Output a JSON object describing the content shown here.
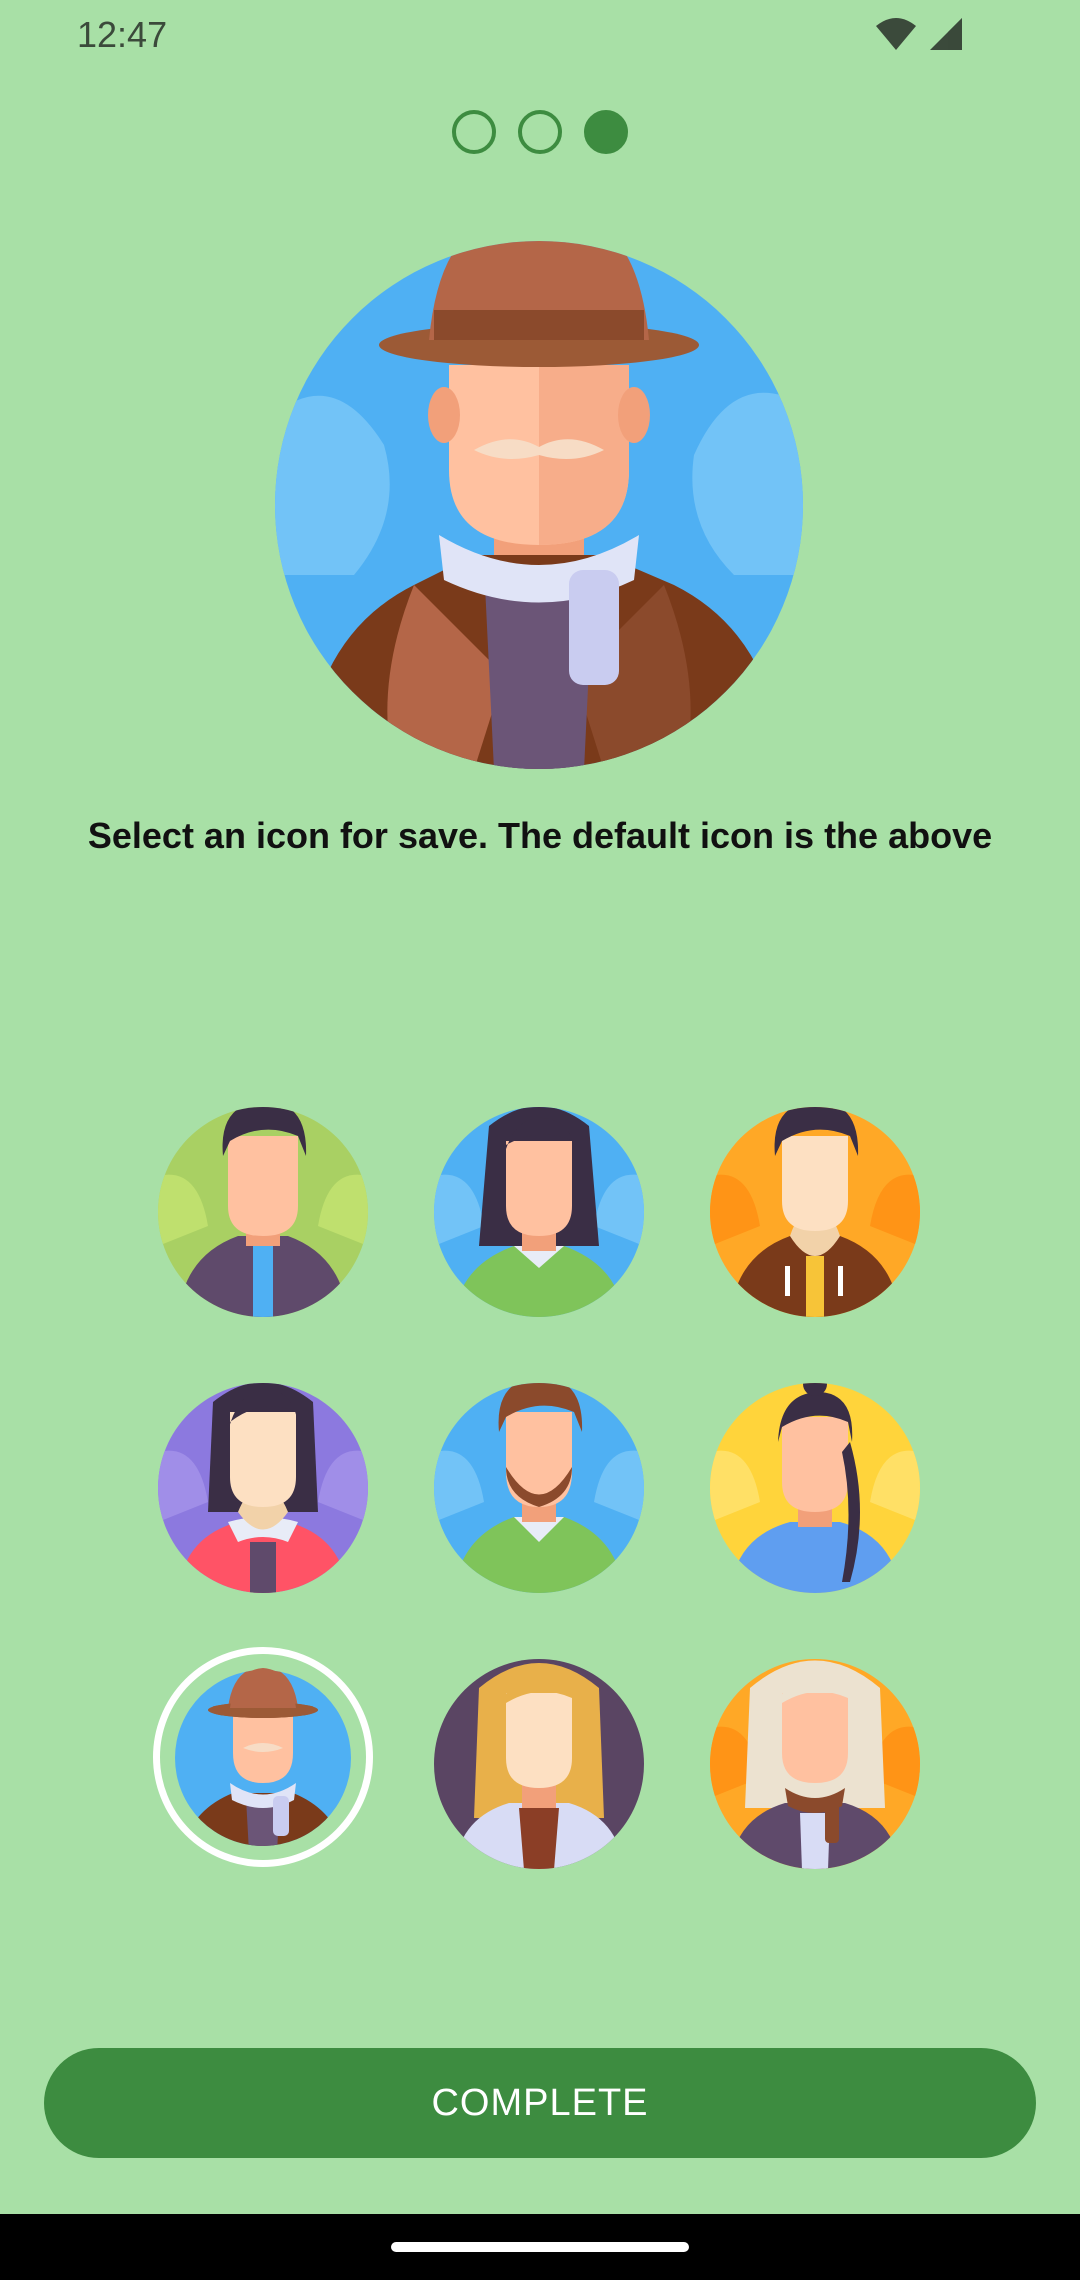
{
  "status_bar": {
    "time": "12:47",
    "icons": [
      "wifi-icon",
      "cellular-signal-icon"
    ]
  },
  "pager": {
    "total_pages": 3,
    "current_page": 3
  },
  "hero": {
    "icon": "avatar-man-hat-mustache"
  },
  "instruction": "Select an icon for save. The default icon is the above",
  "avatars": [
    {
      "name": "avatar-man-dark-hair",
      "selected": false
    },
    {
      "name": "avatar-woman-long-hair",
      "selected": false
    },
    {
      "name": "avatar-man-brown-jacket",
      "selected": false
    },
    {
      "name": "avatar-woman-pink-hoodie",
      "selected": false
    },
    {
      "name": "avatar-man-beard",
      "selected": false
    },
    {
      "name": "avatar-woman-ponytail",
      "selected": false
    },
    {
      "name": "avatar-man-hat-mustache",
      "selected": true
    },
    {
      "name": "avatar-woman-blonde",
      "selected": false
    },
    {
      "name": "avatar-woman-white-hair-scarf",
      "selected": false
    }
  ],
  "complete_button": {
    "label": "COMPLETE"
  },
  "colors": {
    "background": "#a8e0a6",
    "accent": "#3d8c40",
    "text": "#111111"
  }
}
